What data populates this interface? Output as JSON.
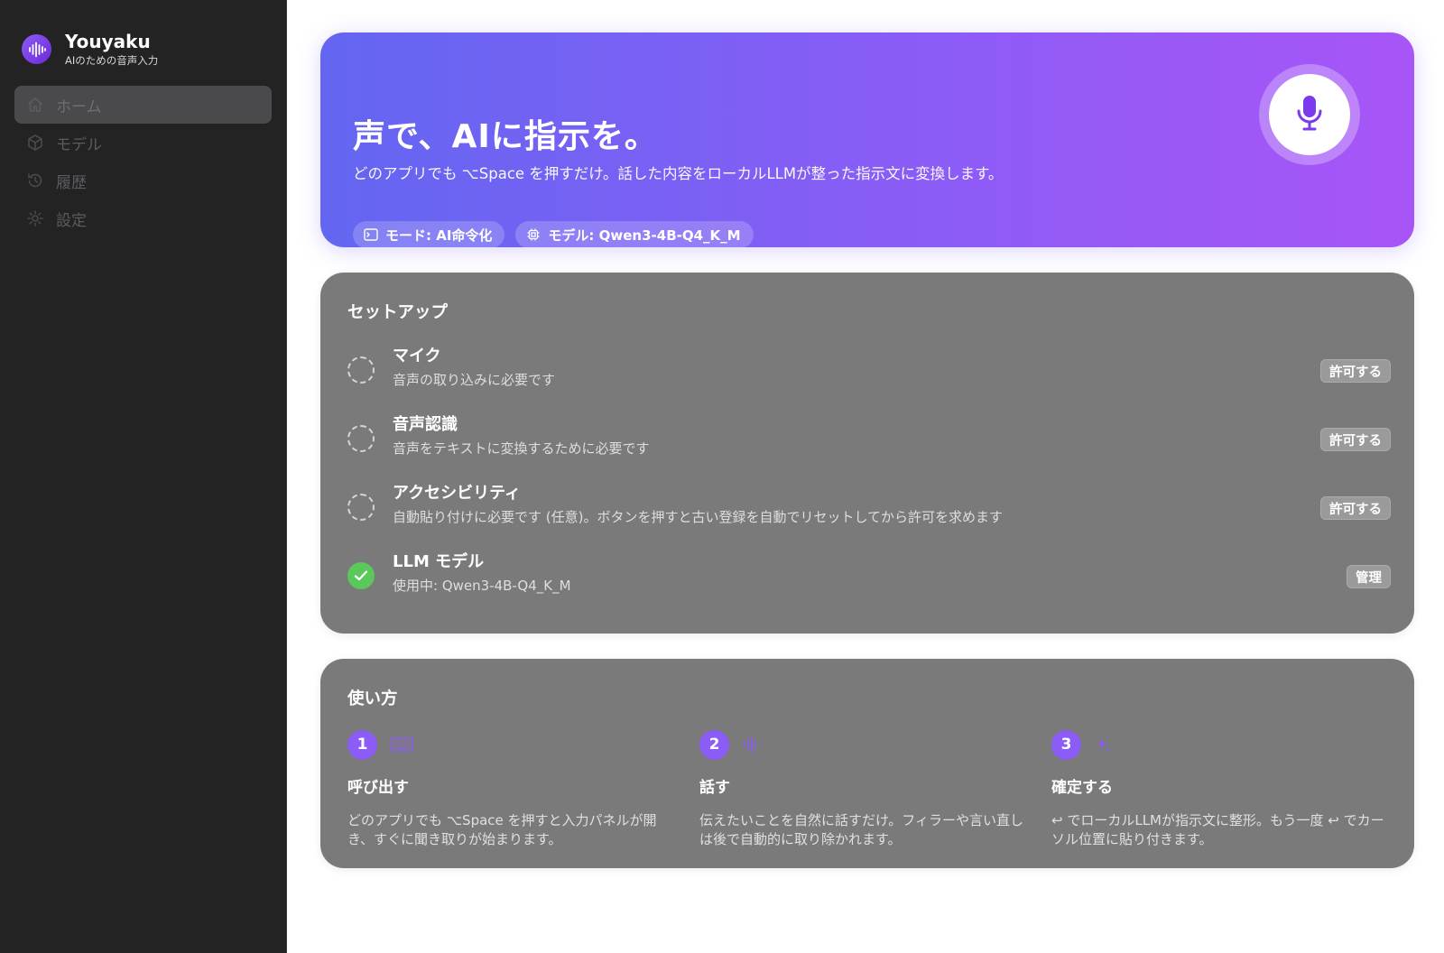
{
  "app": {
    "name": "Youyaku",
    "tagline": "AIのための音声入力"
  },
  "sidebar": {
    "items": [
      {
        "label": "ホーム",
        "icon": "home-icon",
        "active": true
      },
      {
        "label": "モデル",
        "icon": "cube-icon",
        "active": false
      },
      {
        "label": "履歴",
        "icon": "history-icon",
        "active": false
      },
      {
        "label": "設定",
        "icon": "gear-icon",
        "active": false
      }
    ]
  },
  "hero": {
    "title": "声で、AIに指示を。",
    "subtitle": "どのアプリでも ⌥Space を押すだけ。話した内容をローカルLLMが整った指示文に変換します。",
    "chips": [
      {
        "icon": "terminal-icon",
        "label": "モード: AI命令化"
      },
      {
        "icon": "chip-icon",
        "label": "モデル: Qwen3-4B-Q4_K_M"
      }
    ],
    "mic_icon": "microphone-icon"
  },
  "setup": {
    "title": "セットアップ",
    "rows": [
      {
        "title": "マイク",
        "desc": "音声の取り込みに必要です",
        "status": "pending",
        "button": "許可する"
      },
      {
        "title": "音声認識",
        "desc": "音声をテキストに変換するために必要です",
        "status": "pending",
        "button": "許可する"
      },
      {
        "title": "アクセシビリティ",
        "desc": "自動貼り付けに必要です (任意)。ボタンを押すと古い登録を自動でリセットしてから許可を求めます",
        "status": "pending",
        "button": "許可する"
      },
      {
        "title": "LLM モデル",
        "desc": "使用中: Qwen3-4B-Q4_K_M",
        "status": "done",
        "button": "管理"
      }
    ]
  },
  "howto": {
    "title": "使い方",
    "steps": [
      {
        "num": "1",
        "icon": "keyboard-icon",
        "title": "呼び出す",
        "desc": "どのアプリでも ⌥Space を押すと入力パネルが開き、すぐに聞き取りが始まります。"
      },
      {
        "num": "2",
        "icon": "waveform-icon",
        "title": "話す",
        "desc": "伝えたいことを自然に話すだけ。フィラーや言い直しは後で自動的に取り除かれます。"
      },
      {
        "num": "3",
        "icon": "sparkle-icon",
        "title": "確定する",
        "desc": "↩ でローカルLLMが指示文に整形。もう一度 ↩ でカーソル位置に貼り付きます。"
      }
    ]
  },
  "colors": {
    "accent": "#8b5cf6",
    "hero_start": "#6366f1",
    "hero_end": "#a855f7",
    "success": "#5ac85a",
    "sidebar_bg": "#232324",
    "card_bg": "#7a7a7a"
  }
}
